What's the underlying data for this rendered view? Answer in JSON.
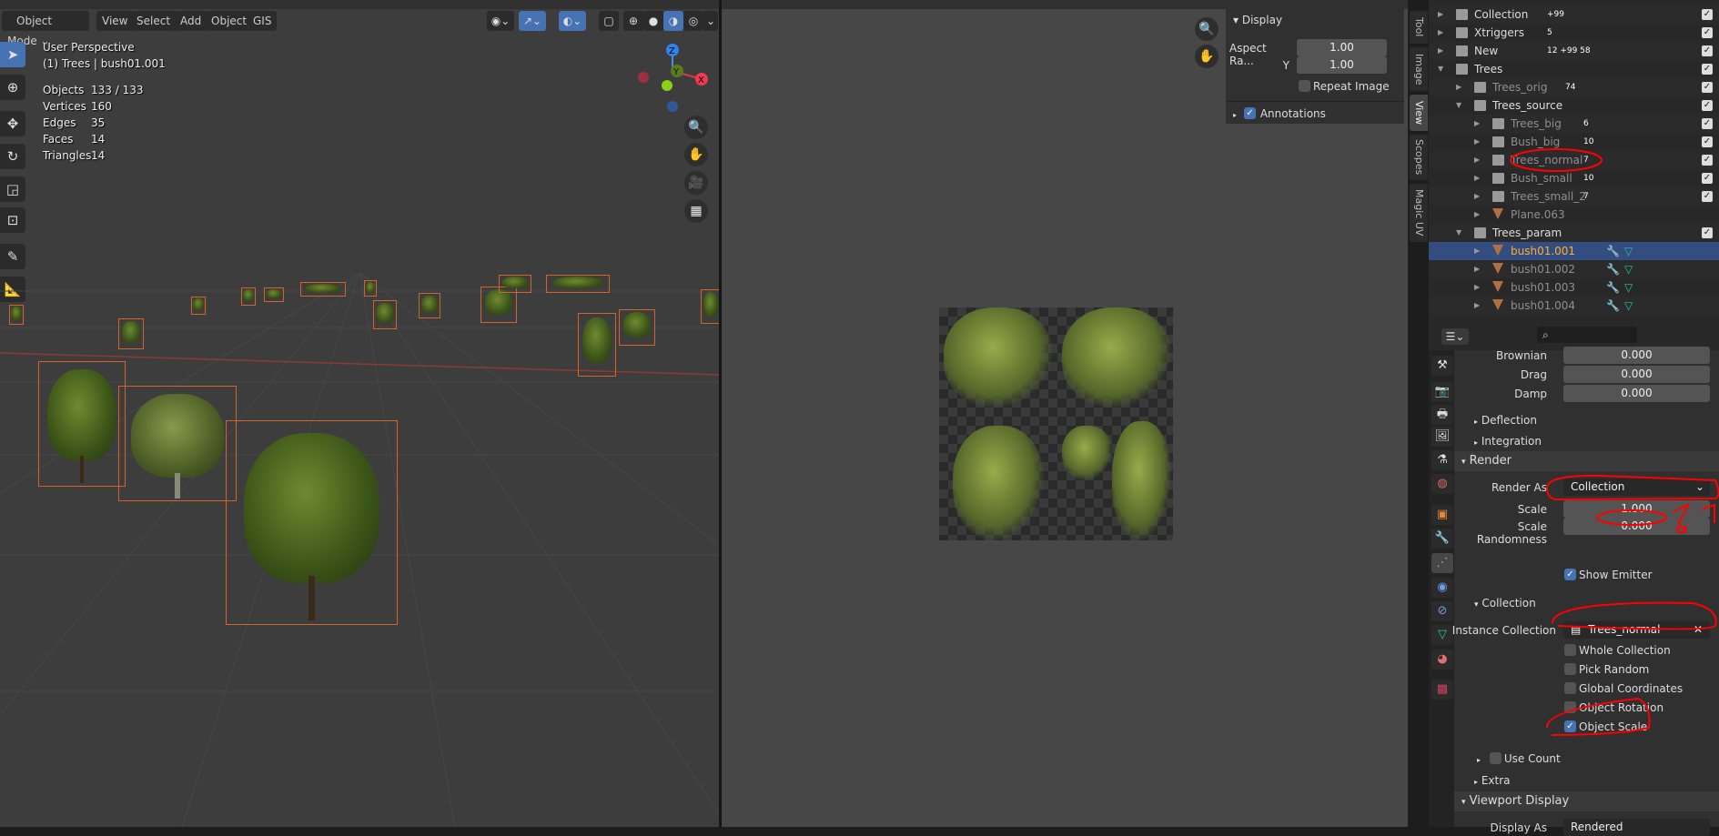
{
  "viewport": {
    "menu": [
      "Object Mode",
      "View",
      "Select",
      "Add",
      "Object",
      "GIS"
    ],
    "title": "User Perspective",
    "subtitle": "(1) Trees | bush01.001",
    "stats": [
      {
        "label": "Objects",
        "value": "133 / 133"
      },
      {
        "label": "Vertices",
        "value": "160"
      },
      {
        "label": "Edges",
        "value": "35"
      },
      {
        "label": "Faces",
        "value": "14"
      },
      {
        "label": "Triangles",
        "value": "14"
      }
    ],
    "gizmo": {
      "x": "X",
      "y": "Y",
      "z": "Z"
    },
    "tools": [
      "select-box",
      "cursor",
      "move",
      "rotate",
      "scale",
      "transform",
      "annotate",
      "measure"
    ]
  },
  "image_editor": {
    "display_header": "Display",
    "aspect_label": "Aspect Ra...",
    "aspect_x": "1.00",
    "y_label": "Y",
    "aspect_y": "1.00",
    "repeat_image": "Repeat Image",
    "annotations": "Annotations",
    "tabs": [
      "Tool",
      "Image",
      "View",
      "Scopes",
      "Magic UV"
    ]
  },
  "outliner": {
    "rows": [
      {
        "name": "Collection",
        "count": "+99",
        "depth": 0
      },
      {
        "name": "Xtriggers",
        "count": "5",
        "depth": 0
      },
      {
        "name": "New",
        "count": "12  +99  58",
        "depth": 0
      },
      {
        "name": "Trees",
        "count": "",
        "depth": 0
      },
      {
        "name": "Trees_orig",
        "count": "74",
        "depth": 1
      },
      {
        "name": "Trees_source",
        "count": "",
        "depth": 1
      },
      {
        "name": "Trees_big",
        "count": "6",
        "depth": 2
      },
      {
        "name": "Bush_big",
        "count": "10",
        "depth": 2
      },
      {
        "name": "Trees_normal",
        "count": "7",
        "depth": 2
      },
      {
        "name": "Bush_small",
        "count": "10",
        "depth": 2
      },
      {
        "name": "Trees_small_2",
        "count": "7",
        "depth": 2
      },
      {
        "name": "Plane.063",
        "count": "",
        "depth": 2
      },
      {
        "name": "Trees_param",
        "count": "",
        "depth": 1
      },
      {
        "name": "bush01.001",
        "count": "",
        "depth": 2
      },
      {
        "name": "bush01.002",
        "count": "",
        "depth": 2
      },
      {
        "name": "bush01.003",
        "count": "",
        "depth": 2
      },
      {
        "name": "bush01.004",
        "count": "",
        "depth": 2
      }
    ]
  },
  "properties": {
    "brownian_label": "Brownian",
    "brownian": "0.000",
    "drag_label": "Drag",
    "drag": "0.000",
    "damp_label": "Damp",
    "damp": "0.000",
    "deflection": "Deflection",
    "integration": "Integration",
    "render": "Render",
    "render_as_label": "Render As",
    "render_as": "Collection",
    "scale_label": "Scale",
    "scale": "1.000",
    "scale_rand_label": "Scale Randomness",
    "scale_rand": "0.000",
    "show_emitter": "Show Emitter",
    "collection": "Collection",
    "instance_label": "Instance Collection",
    "instance": "Trees_normal",
    "whole_collection": "Whole Collection",
    "pick_random": "Pick Random",
    "global_coords": "Global Coordinates",
    "object_rotation": "Object Rotation",
    "object_scale": "Object Scale",
    "use_count": "Use Count",
    "extra": "Extra",
    "viewport_display": "Viewport Display",
    "display_as_label": "Display As",
    "display_as": "Rendered"
  },
  "colors": {
    "accent": "#4772b3",
    "selected": "#ffaf29",
    "annotation": "#ff0000"
  }
}
